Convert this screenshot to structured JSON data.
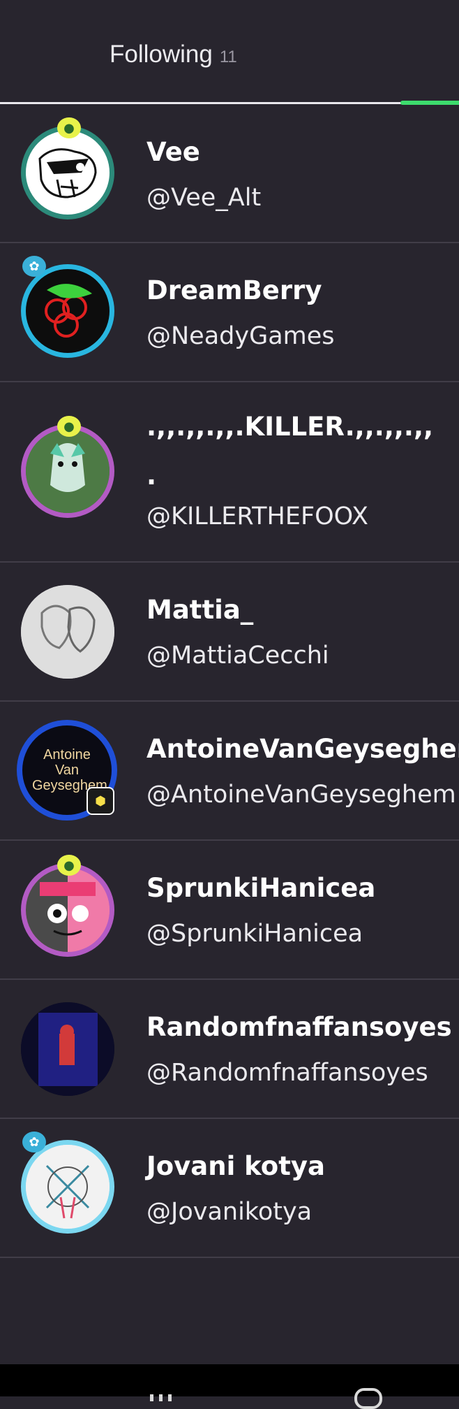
{
  "tab": {
    "label": "Following",
    "count": "11"
  },
  "users": [
    {
      "display_name": "Vee",
      "handle": "@Vee_Alt"
    },
    {
      "display_name": "DreamBerry",
      "handle": "@NeadyGames"
    },
    {
      "display_name": ".,,.,,.,,.KILLER.,,.,,.,,",
      "display_name_2": ".",
      "handle": "@KILLERTHEFOOX"
    },
    {
      "display_name": "Mattia_",
      "handle": "@MattiaCecchi"
    },
    {
      "display_name": "AntoineVanGeyseghem",
      "handle": "@AntoineVanGeyseghem",
      "avatar_text": "Antoine Van Geyseghem"
    },
    {
      "display_name": "SprunkiHanicea",
      "handle": "@SprunkiHanicea"
    },
    {
      "display_name": "Randomfnaffansoyes",
      "handle": "@Randomfnaffansoyes"
    },
    {
      "display_name": "Jovani kotya",
      "handle": "@Jovanikotya"
    }
  ],
  "colors": {
    "background": "#28252e",
    "divider": "#413d48",
    "accent": "#3ddc6d"
  }
}
